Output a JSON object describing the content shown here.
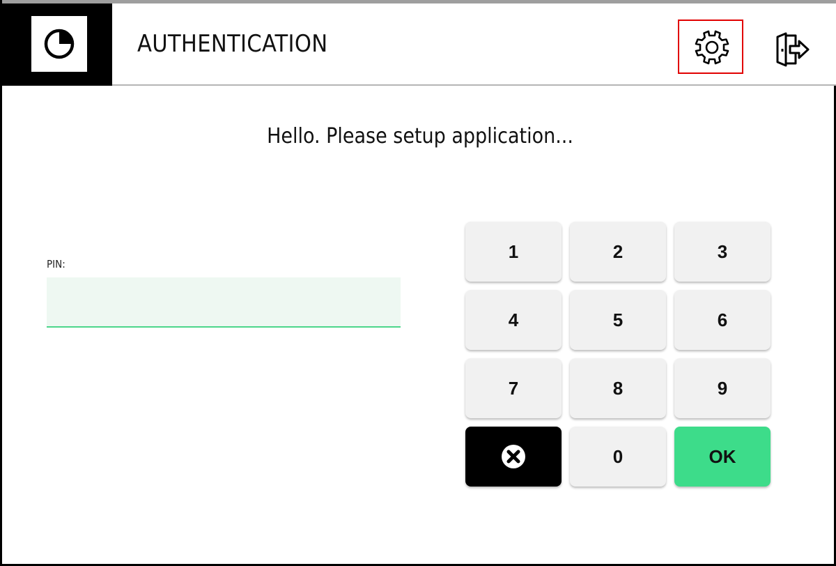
{
  "header": {
    "title": "AUTHENTICATION",
    "icons": {
      "logo": "pie-chart-icon",
      "settings": "gear-icon",
      "exit": "exit-door-icon"
    }
  },
  "main": {
    "greeting": "Hello. Please setup application...",
    "pin": {
      "label": "PIN:",
      "value": "",
      "placeholder": ""
    }
  },
  "keypad": {
    "keys": [
      "1",
      "2",
      "3",
      "4",
      "5",
      "6",
      "7",
      "8",
      "9"
    ],
    "zero": "0",
    "ok": "OK",
    "clear_icon": "clear-x-icon"
  },
  "colors": {
    "accent": "#3ddc8a",
    "pin_field_bg": "#eef8f2",
    "pin_field_underline": "#4cd68a",
    "key_bg": "#f1f1f1",
    "highlight_border": "#e10000"
  }
}
